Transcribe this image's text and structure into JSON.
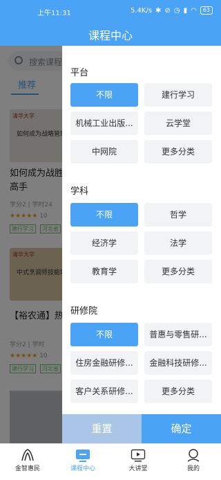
{
  "status_bar": {
    "time": "上午11:31",
    "net_speed": "5.4K/s",
    "battery": "63"
  },
  "header": {
    "title": "课程中心"
  },
  "background": {
    "search_placeholder": "搜索课程",
    "tab_recommended": "推荐",
    "course1": {
      "thumb_logo": "清华大学",
      "thumb_caption": "如何成为战略管理的高手",
      "title_line1": "如何成为战胜",
      "title_line2": "高手",
      "meta": "学分2  |  学时24",
      "rating": "10",
      "tags": [
        "建行学习",
        "河北省"
      ]
    },
    "course2": {
      "thumb_logo": "清华大学",
      "thumb_caption": "中式烹调师技能培训",
      "title": "【裕农通】热",
      "meta": "学分2  |  学时",
      "rating": "10",
      "tags": [
        "建行学习",
        "河北省"
      ]
    }
  },
  "filter_panel": {
    "sections": [
      {
        "title": "平台",
        "options": [
          "不限",
          "建行学习",
          "机械工业出版...",
          "云学堂",
          "中网院",
          "更多分类"
        ],
        "selected": 0
      },
      {
        "title": "学科",
        "options": [
          "不限",
          "哲学",
          "经济学",
          "法学",
          "教育学",
          "更多分类"
        ],
        "selected": 0
      },
      {
        "title": "研修院",
        "options": [
          "不限",
          "普惠与零售研...",
          "住房金融研修...",
          "金融科技研修...",
          "客户关系研修...",
          "更多分类"
        ],
        "selected": 0
      }
    ],
    "reset_label": "重置",
    "confirm_label": "确定"
  },
  "bottom_nav": {
    "items": [
      {
        "label": "金智惠民",
        "icon": "jinzhi-logo-icon"
      },
      {
        "label": "课程中心",
        "icon": "course-screen-icon"
      },
      {
        "label": "大讲堂",
        "icon": "play-screen-icon"
      },
      {
        "label": "我的",
        "icon": "user-icon"
      }
    ],
    "active": 1
  },
  "colors": {
    "accent": "#4aa3f5",
    "reset_bg": "#a9c6e8",
    "option_bg": "#f2f3f5"
  }
}
